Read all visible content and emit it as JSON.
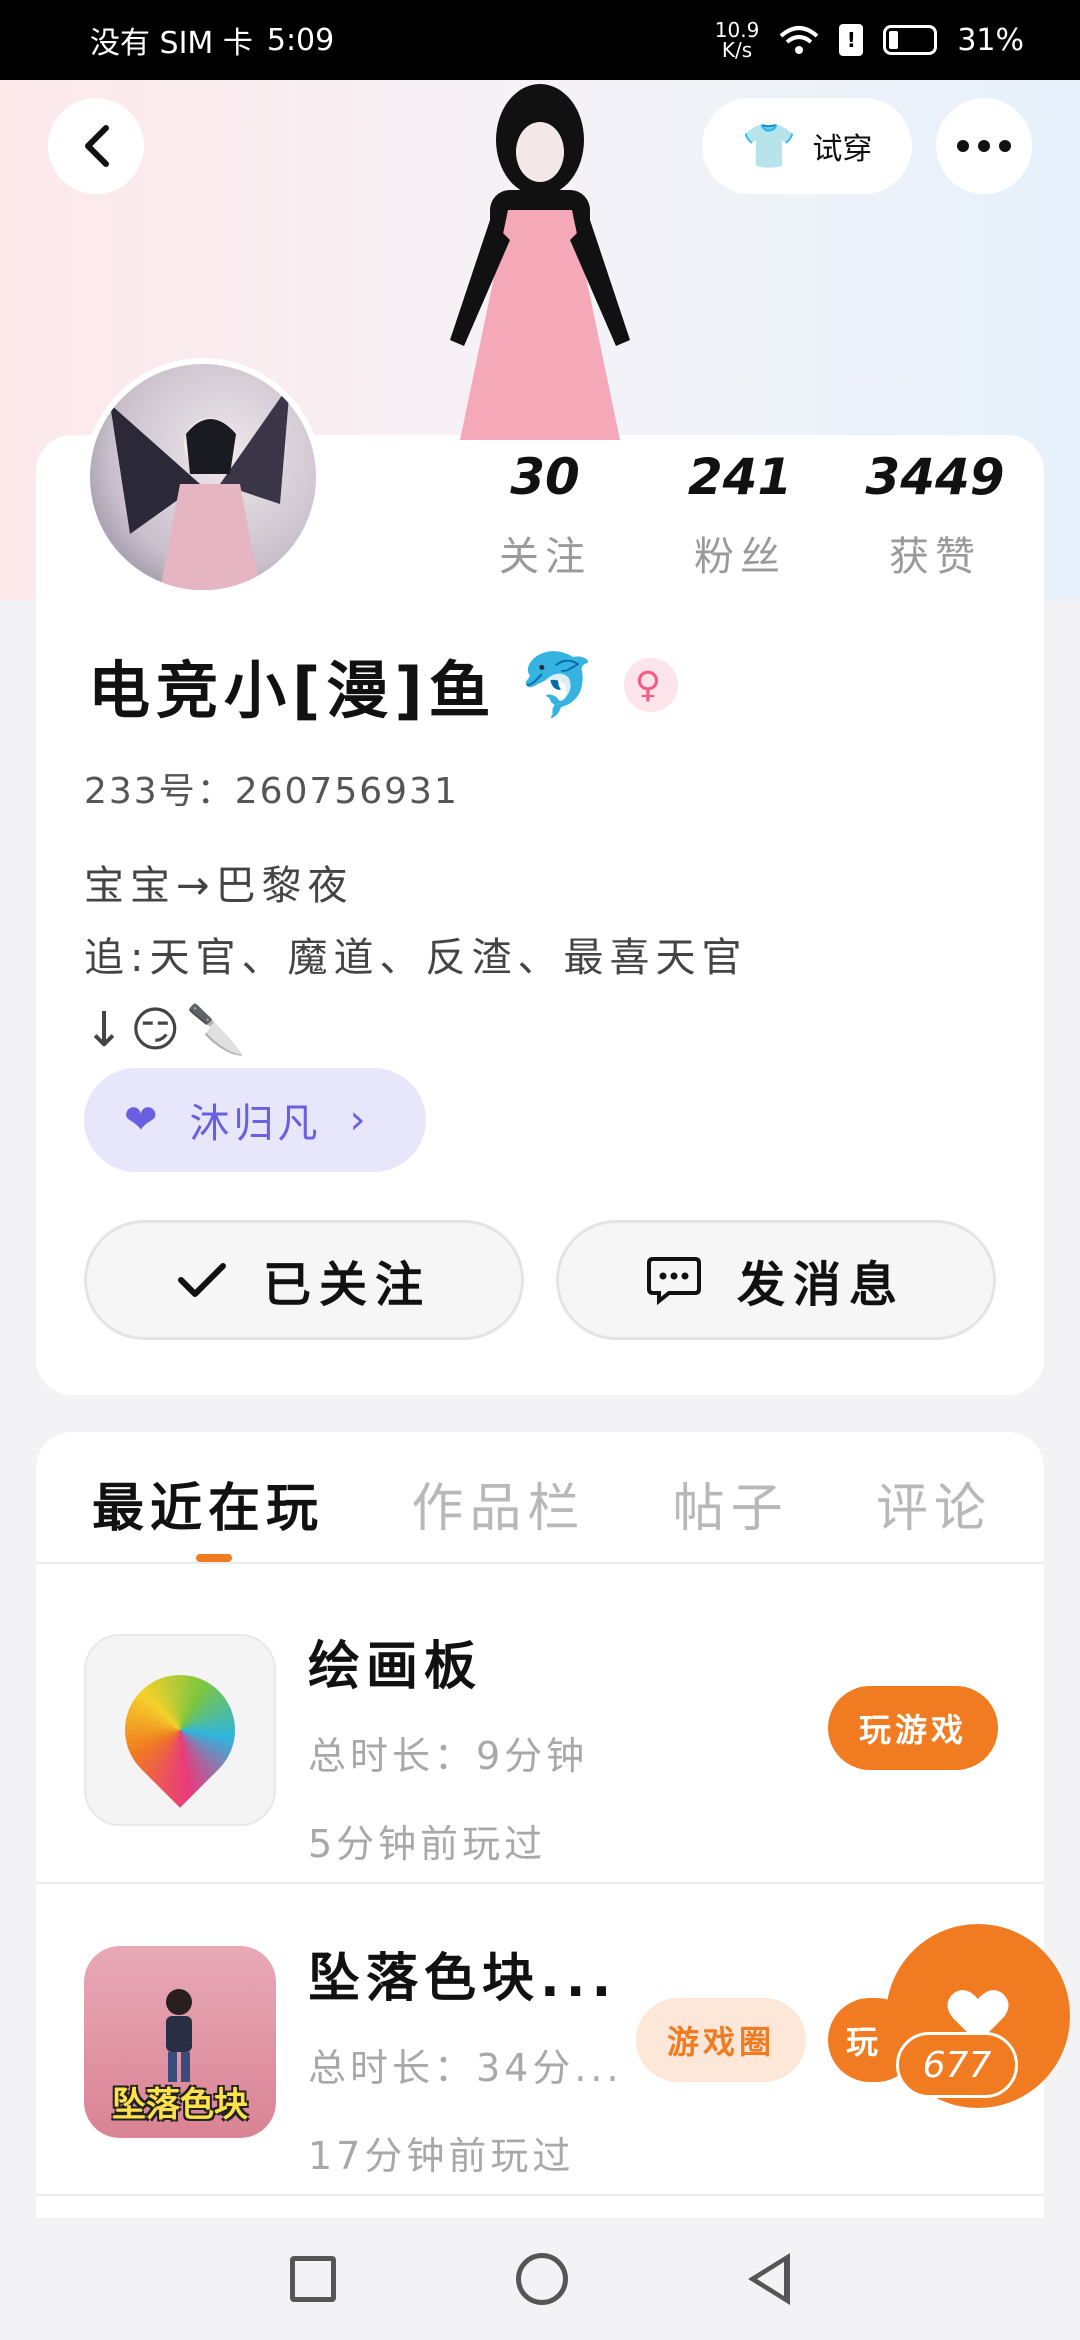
{
  "status_bar": {
    "carrier": "没有 SIM 卡",
    "time": "5:09",
    "net_speed_value": "10.9",
    "net_speed_unit": "K/s",
    "battery_text": "31%"
  },
  "header": {
    "back_icon": "chevron-left-icon",
    "tryon_label": "试穿",
    "more_icon": "more-dots-icon"
  },
  "profile": {
    "stats": [
      {
        "value": "30",
        "label": "关注"
      },
      {
        "value": "241",
        "label": "粉丝"
      },
      {
        "value": "3449",
        "label": "获赞"
      }
    ],
    "nickname": "电竞小[漫]鱼",
    "nickname_emoji": "🐬",
    "gender_symbol": "♀",
    "uid": "233号：260756931",
    "bio_lines": [
      "宝宝→巴黎夜",
      "追:天官、魔道、反渣、最喜天官",
      "↓😏🔪"
    ],
    "guild_name": "沐归凡",
    "guild_chevron": "›",
    "follow_button": "已关注",
    "message_button": "发消息"
  },
  "tabs": [
    {
      "label": "最近在玩",
      "active": true
    },
    {
      "label": "作品栏",
      "active": false
    },
    {
      "label": "帖子",
      "active": false
    },
    {
      "label": "评论",
      "active": false
    }
  ],
  "games": [
    {
      "name": "绘画板",
      "total_time": "总时长：9分钟",
      "last_played": "5分钟前玩过",
      "play_label": "玩游戏"
    },
    {
      "name": "坠落色块...",
      "icon_caption": "坠落色块",
      "total_time": "总时长：34分...",
      "last_played": "17分钟前玩过",
      "circle_label": "游戏圈",
      "play_label": "玩"
    }
  ],
  "like_fab": {
    "icon": "heart-icon",
    "count": "677"
  },
  "colors": {
    "accent": "#f07b21",
    "guild": "#6a5fe0",
    "gender": "#f45b8a"
  }
}
